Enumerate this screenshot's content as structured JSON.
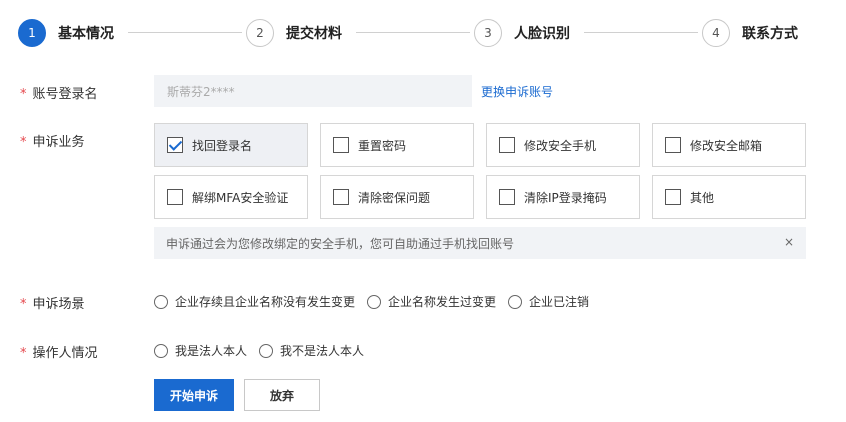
{
  "steps": [
    {
      "num": "1",
      "label": "基本情况",
      "active": true
    },
    {
      "num": "2",
      "label": "提交材料",
      "active": false
    },
    {
      "num": "3",
      "label": "人脸识别",
      "active": false
    },
    {
      "num": "4",
      "label": "联系方式",
      "active": false
    }
  ],
  "form": {
    "required_mark": "*",
    "account": {
      "label": "账号登录名",
      "value": "斯蒂芬2****",
      "change_link": "更换申诉账号"
    },
    "business": {
      "label": "申诉业务",
      "options": [
        {
          "label": "找回登录名",
          "checked": true
        },
        {
          "label": "重置密码",
          "checked": false
        },
        {
          "label": "修改安全手机",
          "checked": false
        },
        {
          "label": "修改安全邮箱",
          "checked": false
        },
        {
          "label": "解绑MFA安全验证",
          "checked": false
        },
        {
          "label": "清除密保问题",
          "checked": false
        },
        {
          "label": "清除IP登录掩码",
          "checked": false
        },
        {
          "label": "其他",
          "checked": false
        }
      ],
      "notice": "申诉通过会为您修改绑定的安全手机，您可自助通过手机找回账号",
      "notice_close": "×"
    },
    "scenario": {
      "label": "申诉场景",
      "options": [
        "企业存续且企业名称没有发生变更",
        "企业名称发生过变更",
        "企业已注销"
      ]
    },
    "operator": {
      "label": "操作人情况",
      "options": [
        "我是法人本人",
        "我不是法人本人"
      ]
    }
  },
  "buttons": {
    "start": "开始申诉",
    "abandon": "放弃"
  },
  "colors": {
    "primary": "#1a6ad0",
    "required": "#e5484d"
  }
}
